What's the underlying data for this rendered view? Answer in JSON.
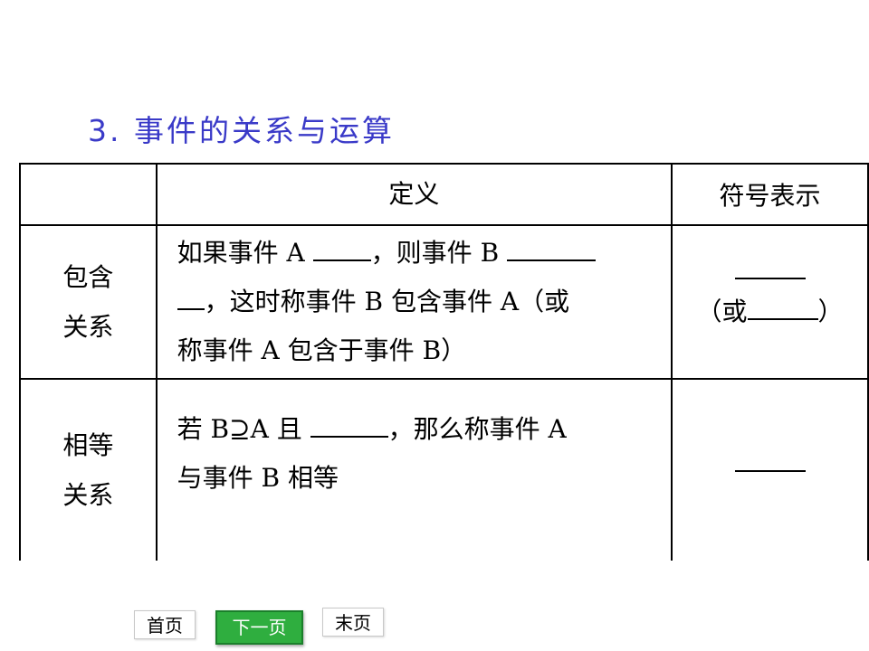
{
  "title": "3. 事件的关系与运算",
  "table": {
    "headers": [
      "",
      "定义",
      "符号表示"
    ],
    "rows": [
      {
        "label_line1": "包含",
        "label_line2": "关系",
        "def_line1_a": "如果事件 A",
        "def_line1_b": "，则事件 B",
        "def_line2_b": "，这时称事件 B 包含事件 A（或",
        "def_line3": "称事件 A 包含于事件 B）",
        "symbol_alt_open": "（或",
        "symbol_alt_close": "）"
      },
      {
        "label_line1": "相等",
        "label_line2": "关系",
        "def_line1_a": "若 B⊇A 且",
        "def_line1_b": "，那么称事件 A",
        "def_line2": "与事件 B 相等"
      }
    ]
  },
  "nav": {
    "first": "首页",
    "next": "下一页",
    "last": "末页"
  }
}
